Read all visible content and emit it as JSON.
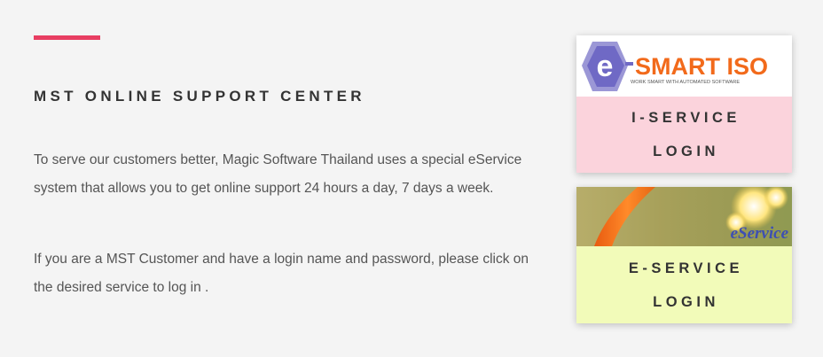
{
  "section": {
    "heading": "MST ONLINE SUPPORT CENTER",
    "paragraphs": [
      "To serve our customers better, Magic Software Thailand uses a special eService system that allows you to get online support 24 hours a day, 7 days a week.",
      "If you are a MST Customer and have a login name and password, please click on the desired service to log in ."
    ]
  },
  "cards": [
    {
      "logo_letter": "e",
      "logo_title": "SMART ISO",
      "logo_tagline": "WORK SMART WITH AUTOMATED SOFTWARE",
      "label_line1": "I-SERVICE",
      "label_line2": "LOGIN",
      "bg": "#fbd3dc"
    },
    {
      "logo_text": "eService",
      "label_line1": "E-SERVICE",
      "label_line2": "LOGIN",
      "bg": "#f2fbb9"
    }
  ],
  "colors": {
    "accent": "#e83e62",
    "background": "#f4f4f4"
  }
}
